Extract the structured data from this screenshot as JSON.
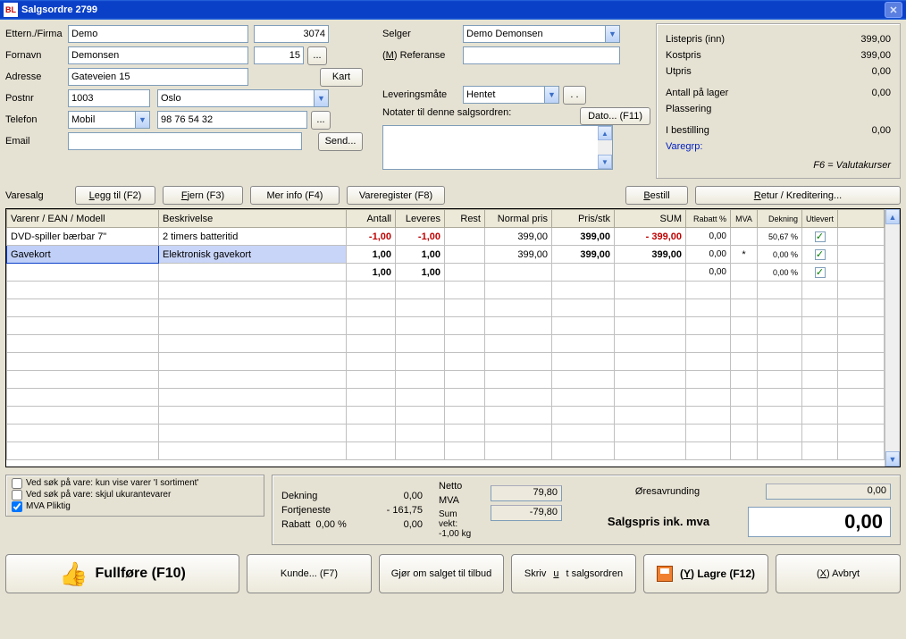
{
  "window": {
    "title": "Salgsordre 2799"
  },
  "customer": {
    "labels": {
      "etternavn": "Ettern./Firma",
      "fornavn": "Fornavn",
      "adresse": "Adresse",
      "postnr": "Postnr",
      "telefon": "Telefon",
      "email": "Email"
    },
    "etternavn": "Demo",
    "custno": "3074",
    "fornavn": "Demonsen",
    "fornavn_no": "15",
    "adresse": "Gateveien 15",
    "kart_btn": "Kart",
    "postnr": "1003",
    "poststed": "Oslo",
    "telefon_type": "Mobil",
    "telefon": "98 76 54 32",
    "email": "",
    "send_btn": "Send...",
    "ellipsis": "..."
  },
  "seller": {
    "labels": {
      "selger": "Selger",
      "referanse_pre": "(",
      "referanse_u": "M",
      "referanse_post": ") Referanse",
      "leveringsmate": "Leveringsmåte",
      "notater": "Notater til denne salgsordren:"
    },
    "selger": "Demo Demonsen",
    "referanse": "",
    "leveringsmate": "Hentet",
    "dato_btn": "Dato... (F11)",
    "dotdot": ". ."
  },
  "pricebox": {
    "listepris_lbl": "Listepris (inn)",
    "listepris": "399,00",
    "kostpris_lbl": "Kostpris",
    "kostpris": "399,00",
    "utpris_lbl": "Utpris",
    "utpris": "0,00",
    "antall_lager_lbl": "Antall på lager",
    "antall_lager": "0,00",
    "plassering_lbl": "Plassering",
    "plassering": "",
    "i_bestilling_lbl": "I bestilling",
    "i_bestilling": "0,00",
    "varegrp_lbl": "Varegrp:",
    "f6": "F6 = Valutakurser"
  },
  "varesalg": {
    "label": "Varesalg",
    "leggtil": "Legg til (F2)",
    "fjern": "Fjern (F3)",
    "merinfo": "Mer info (F4)",
    "vareregister": "Vareregister (F8)",
    "bestill": "Bestill",
    "retur": "Retur / Kreditering..."
  },
  "grid": {
    "headers": {
      "varenr": "Varenr / EAN / Modell",
      "beskrivelse": "Beskrivelse",
      "antall": "Antall",
      "leveres": "Leveres",
      "rest": "Rest",
      "normalpris": "Normal pris",
      "prisstk": "Pris/stk",
      "sum": "SUM",
      "rabatt": "Rabatt %",
      "mva": "MVA",
      "dekning": "Dekning",
      "utlevert": "Utlevert"
    },
    "rows": [
      {
        "varenr": "DVD-spiller bærbar 7\"",
        "beskrivelse": "2 timers batteritid",
        "antall": "-1,00",
        "antall_neg": true,
        "leveres": "-1,00",
        "leveres_neg": true,
        "rest": "",
        "normalpris": "399,00",
        "prisstk": "399,00",
        "sum": "- 399,00",
        "sum_neg": true,
        "rabatt": "0,00",
        "mva": "",
        "dekning": "50,67 %",
        "utlevert": true
      },
      {
        "varenr": "Gavekort",
        "beskrivelse": "Elektronisk gavekort",
        "antall": "1,00",
        "leveres": "1,00",
        "rest": "",
        "normalpris": "399,00",
        "prisstk": "399,00",
        "sum": "399,00",
        "rabatt": "0,00",
        "mva": "*",
        "dekning": "0,00 %",
        "utlevert": true,
        "highlight": true
      },
      {
        "varenr": "",
        "beskrivelse": "",
        "antall": "1,00",
        "leveres": "1,00",
        "rest": "",
        "normalpris": "",
        "prisstk": "",
        "sum": "",
        "rabatt": "0,00",
        "mva": "",
        "dekning": "0,00 %",
        "utlevert": true
      }
    ]
  },
  "options": {
    "opt1": "Ved søk på vare: kun vise varer 'I sortiment'",
    "opt2": "Ved søk på vare: skjul ukurantevarer",
    "opt3": "MVA Pliktig",
    "opt1_checked": false,
    "opt2_checked": false,
    "opt3_checked": true
  },
  "totals": {
    "dekning_lbl": "Dekning",
    "dekning": "0,00",
    "fortjeneste_lbl": "Fortjeneste",
    "fortjeneste": "- 161,75",
    "rabatt_lbl": "Rabatt",
    "rabatt_pct": "0,00 %",
    "rabatt_val": "0,00",
    "netto_lbl": "Netto",
    "netto": "79,80",
    "mva_lbl": "MVA",
    "mva": "-79,80",
    "sumvekt_lbl": "Sum vekt: -1,00 kg",
    "oresavrunding_lbl": "Øresavrunding",
    "oresavrunding": "0,00",
    "salgspris_lbl": "Salgspris ink. mva",
    "salgspris": "0,00"
  },
  "footer": {
    "fullfore": "Fullføre (F10)",
    "kunde": "Kunde... (F7)",
    "tilbud": "Gjør om salget til tilbud",
    "skrivut": "Skriv ut salgsordren",
    "lagre_pre": "(",
    "lagre_u": "Y",
    "lagre_post": ") Lagre (F12)",
    "avbryt_pre": "(",
    "avbryt_u": "X",
    "avbryt_post": ") Avbryt"
  }
}
